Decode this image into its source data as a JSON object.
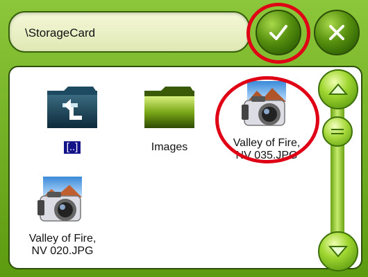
{
  "path": "\\StorageCard",
  "buttons": {
    "ok": "check-icon",
    "cancel": "close-icon"
  },
  "items": [
    {
      "label": "[..]",
      "icon": "up-folder-icon"
    },
    {
      "label": "Images",
      "icon": "folder-icon"
    },
    {
      "label_line1": "Valley of Fire,",
      "label_line2": "NV 035.JPG",
      "icon": "camera-photo-icon"
    },
    {
      "label_line1": "Valley of Fire,",
      "label_line2": "NV 020.JPG",
      "icon": "camera-photo-icon"
    }
  ],
  "colors": {
    "accent": "#6aa314",
    "annotation": "#e00016",
    "up_label_bg": "#14148a"
  }
}
